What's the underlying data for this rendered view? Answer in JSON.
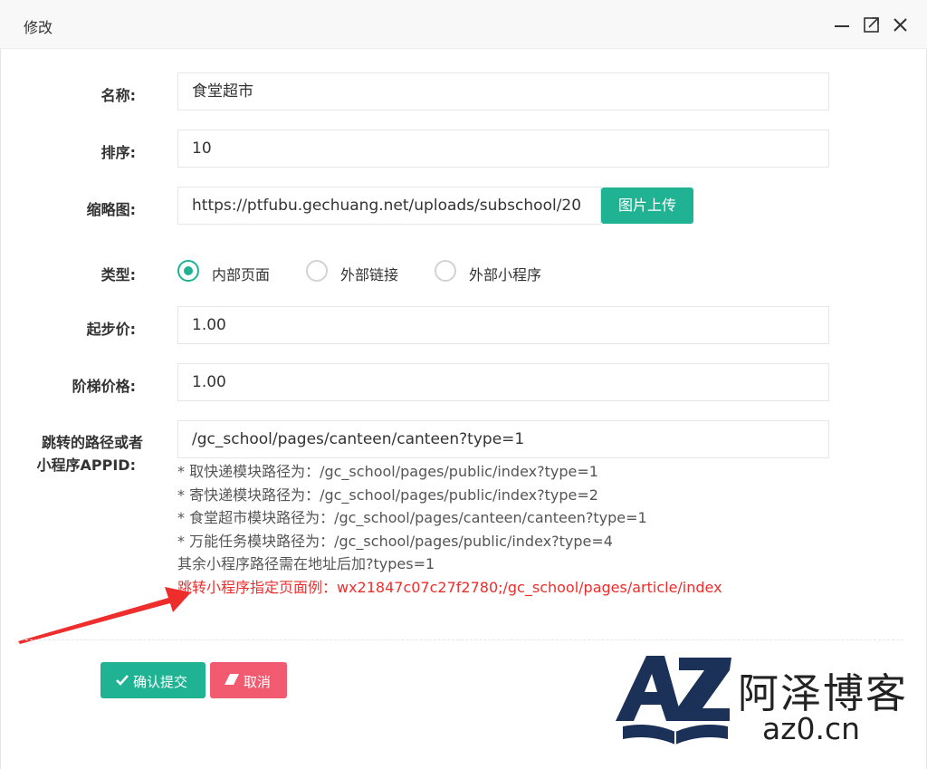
{
  "dialog": {
    "title": "修改"
  },
  "form": {
    "name_label": "名称:",
    "name_value": "食堂超市",
    "sort_label": "排序:",
    "sort_value": "10",
    "thumb_label": "缩略图:",
    "thumb_value": "https://ptfubu.gechuang.net/uploads/subschool/20",
    "upload_button": "图片上传",
    "type_label": "类型:",
    "type_options": [
      {
        "label": "内部页面",
        "checked": true
      },
      {
        "label": "外部链接",
        "checked": false
      },
      {
        "label": "外部小程序",
        "checked": false
      }
    ],
    "start_price_label": "起步价:",
    "start_price_value": "1.00",
    "step_price_label": "阶梯价格:",
    "step_price_value": "1.00",
    "path_label_line1": "跳转的路径或者",
    "path_label_line2": "小程序APPID:",
    "path_value": "/gc_school/pages/canteen/canteen?type=1"
  },
  "hints": [
    "* 取快递模块路径为：/gc_school/pages/public/index?type=1",
    "* 寄快递模块路径为：/gc_school/pages/public/index?type=2",
    "* 食堂超市模块路径为：/gc_school/pages/canteen/canteen?type=1",
    "* 万能任务模块路径为：/gc_school/pages/public/index?type=4",
    "其余小程序路径需在地址后加?types=1"
  ],
  "hint_red": "跳转小程序指定页面例：wx21847c07c27f2780;/gc_school/pages/article/index",
  "actions": {
    "submit": "确认提交",
    "cancel": "取消"
  },
  "watermark": {
    "cn": "阿泽博客",
    "en": "az0.cn"
  },
  "colors": {
    "primary": "#1fb394",
    "danger": "#f25b6f",
    "hint_red": "#ee2d2d",
    "arrow": "#ee2d2d"
  }
}
